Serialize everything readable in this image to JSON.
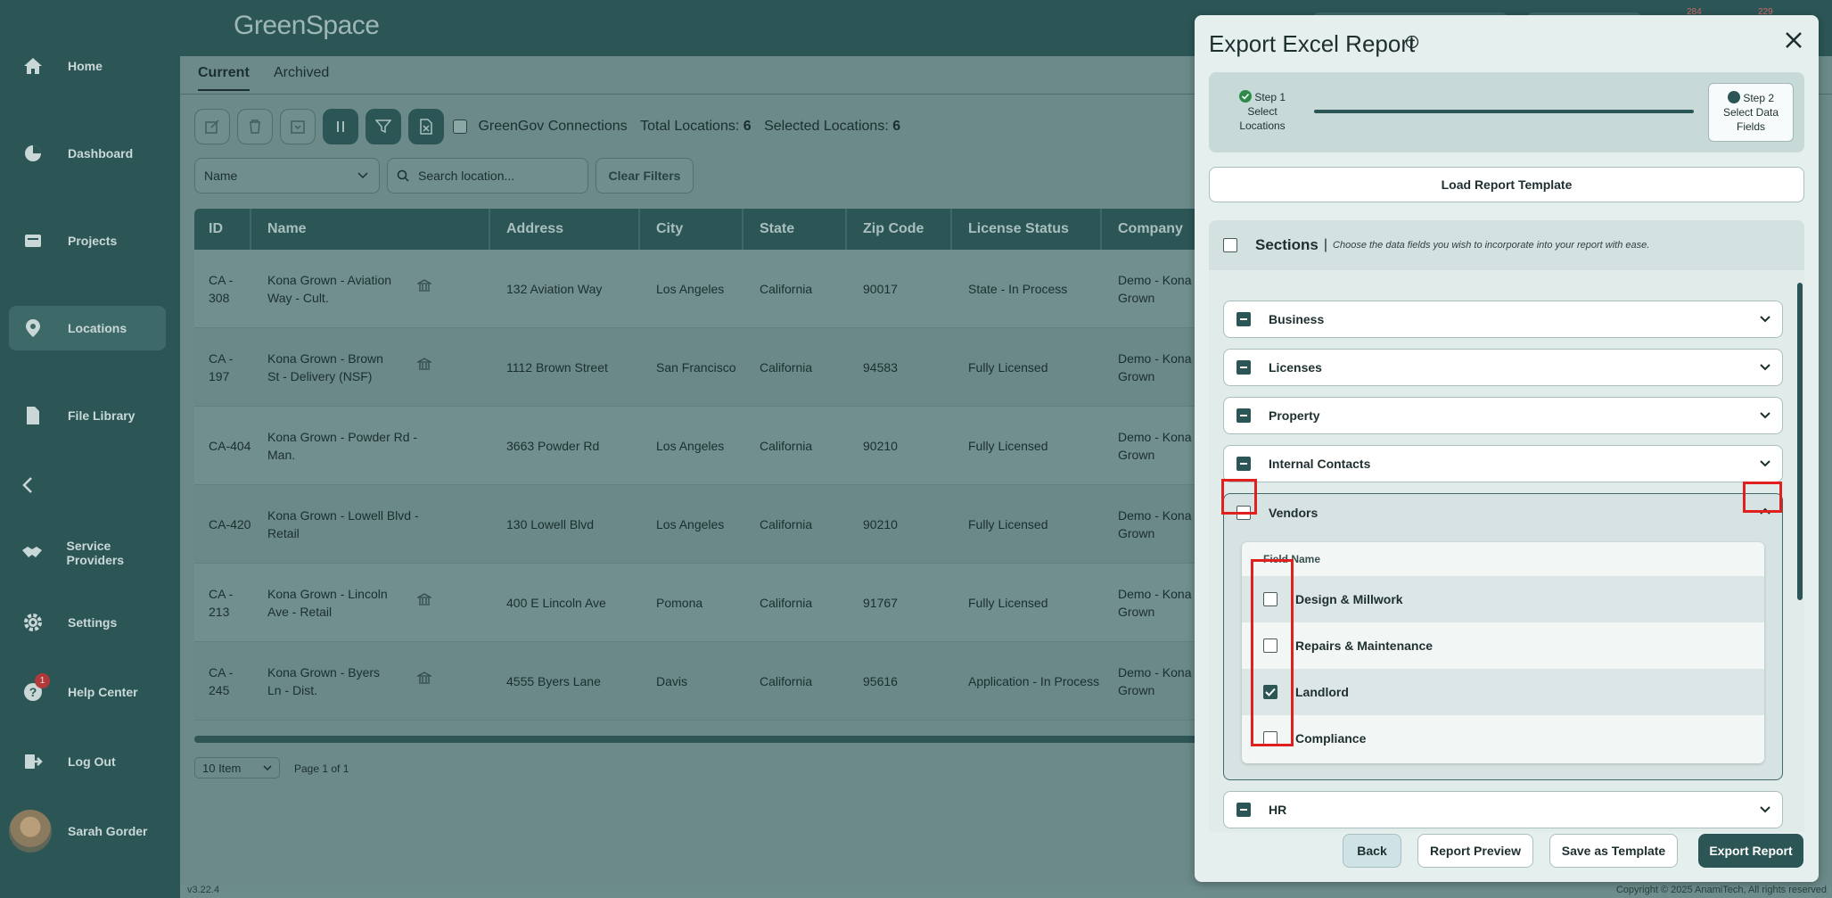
{
  "app": {
    "logo_text": "GreenSpace",
    "version": "v3.22.4",
    "copyright": "Copyright © 2025 AnamiTech, All rights reserved"
  },
  "header": {
    "badge_left": "284",
    "badge_right": "229"
  },
  "sidebar": {
    "items": [
      {
        "label": "Home",
        "icon": "home-icon"
      },
      {
        "label": "Dashboard",
        "icon": "pie-chart-icon"
      },
      {
        "label": "Projects",
        "icon": "projects-icon"
      },
      {
        "label": "Locations",
        "icon": "location-pin-icon"
      },
      {
        "label": "File Library",
        "icon": "file-icon"
      },
      {
        "label": "Service Providers",
        "icon": "handshake-icon"
      },
      {
        "label": "Settings",
        "icon": "gear-icon"
      },
      {
        "label": "Help Center",
        "icon": "help-icon",
        "badge": "1"
      },
      {
        "label": "Log Out",
        "icon": "logout-icon"
      }
    ],
    "user_name": "Sarah Gorder"
  },
  "main": {
    "tabs": [
      "Current",
      "Archived"
    ],
    "greengov_label": "GreenGov Connections",
    "total_label": "Total Locations:",
    "total_value": "6",
    "selected_label": "Selected Locations:",
    "selected_value": "6",
    "filter_field": "Name",
    "search_placeholder": "Search location...",
    "clear_filters": "Clear Filters",
    "columns": [
      "ID",
      "Name",
      "Address",
      "City",
      "State",
      "Zip Code",
      "License Status",
      "Company"
    ],
    "rows": [
      {
        "id_1": "CA -",
        "id_2": "308",
        "name_1": "Kona Grown - Aviation",
        "name_2": "Way - Cult.",
        "bank": true,
        "address": "132 Aviation Way",
        "city": "Los Angeles",
        "state": "California",
        "zip": "90017",
        "status": "State - In Process",
        "company_1": "Demo - Kona",
        "company_2": "Grown"
      },
      {
        "id_1": "CA -",
        "id_2": "197",
        "name_1": "Kona Grown - Brown",
        "name_2": "St - Delivery (NSF)",
        "bank": true,
        "address": "1112 Brown Street",
        "city": "San Francisco",
        "state": "California",
        "zip": "94583",
        "status": "Fully Licensed",
        "company_1": "Demo - Kona",
        "company_2": "Grown"
      },
      {
        "id_1": "CA-404",
        "id_2": "",
        "name_1": "Kona Grown - Powder Rd -",
        "name_2": "Man.",
        "bank": false,
        "address": "3663 Powder Rd",
        "city": "Los Angeles",
        "state": "California",
        "zip": "90210",
        "status": "Fully Licensed",
        "company_1": "Demo - Kona",
        "company_2": "Grown"
      },
      {
        "id_1": "CA-420",
        "id_2": "",
        "name_1": "Kona Grown - Lowell Blvd -",
        "name_2": "Retail",
        "bank": false,
        "address": "130 Lowell Blvd",
        "city": "Los Angeles",
        "state": "California",
        "zip": "90210",
        "status": "Fully Licensed",
        "company_1": "Demo - Kona",
        "company_2": "Grown"
      },
      {
        "id_1": "CA -",
        "id_2": "213",
        "name_1": "Kona Grown - Lincoln",
        "name_2": "Ave - Retail",
        "bank": true,
        "address": "400 E Lincoln Ave",
        "city": "Pomona",
        "state": "California",
        "zip": "91767",
        "status": "Fully Licensed",
        "company_1": "Demo - Kona",
        "company_2": "Grown"
      },
      {
        "id_1": "CA -",
        "id_2": "245",
        "name_1": "Kona Grown - Byers",
        "name_2": "Ln - Dist.",
        "bank": true,
        "address": "4555 Byers Lane",
        "city": "Davis",
        "state": "California",
        "zip": "95616",
        "status": "Application - In Process",
        "company_1": "Demo - Kona",
        "company_2": "Grown"
      }
    ],
    "page_size": "10 Item",
    "page_text": "Page 1 of 1"
  },
  "modal": {
    "title": "Export Excel Report",
    "step1_label": "Step 1",
    "step1_desc_1": "Select",
    "step1_desc_2": "Locations",
    "step2_label": "Step 2",
    "step2_desc_1": "Select Data",
    "step2_desc_2": "Fields",
    "load_template": "Load Report Template",
    "sections_title": "Sections",
    "sections_sep": "|",
    "sections_subtitle": "Choose the data fields you wish to incorporate into your report with ease.",
    "sections": [
      "Business",
      "Licenses",
      "Property",
      "Internal Contacts"
    ],
    "vendors": {
      "label": "Vendors",
      "field_header": "Field Name",
      "fields": [
        {
          "label": "Design & Millwork",
          "checked": false
        },
        {
          "label": "Repairs & Maintenance",
          "checked": false
        },
        {
          "label": "Landlord",
          "checked": true
        },
        {
          "label": "Compliance",
          "checked": false
        }
      ]
    },
    "hr_label": "HR",
    "buttons": {
      "back": "Back",
      "preview": "Report Preview",
      "save_template": "Save as Template",
      "export": "Export Report"
    }
  }
}
